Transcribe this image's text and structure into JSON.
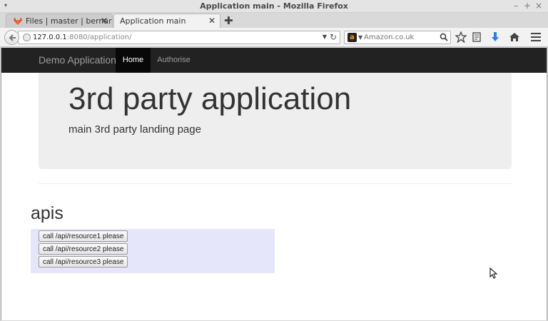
{
  "window": {
    "title": "Application main"
  },
  "browser": {
    "title_suffix": "Application main - Mozilla Firefox",
    "tabs": [
      {
        "label": "Files | master | bernard..."
      },
      {
        "label": "Application main"
      }
    ],
    "url_host": "127.0.0.1",
    "url_path": ":8080/application/",
    "search_placeholder": "Amazon.co.uk"
  },
  "site": {
    "brand": "Demo Application",
    "nav": [
      {
        "label": "Home"
      },
      {
        "label": "Authorise"
      }
    ],
    "jumbotron": {
      "heading": "3rd party application",
      "subtitle": "main 3rd party landing page"
    },
    "apis": {
      "heading": "apis",
      "buttons": [
        {
          "label": "call /api/resource1 please"
        },
        {
          "label": "call /api/resource2 please"
        },
        {
          "label": "call /api/resource3 please"
        }
      ]
    }
  },
  "colors": {
    "navbar_bg": "#222222",
    "jumbotron_bg": "#eeeeee",
    "apis_box_bg": "#e6e6fa"
  }
}
